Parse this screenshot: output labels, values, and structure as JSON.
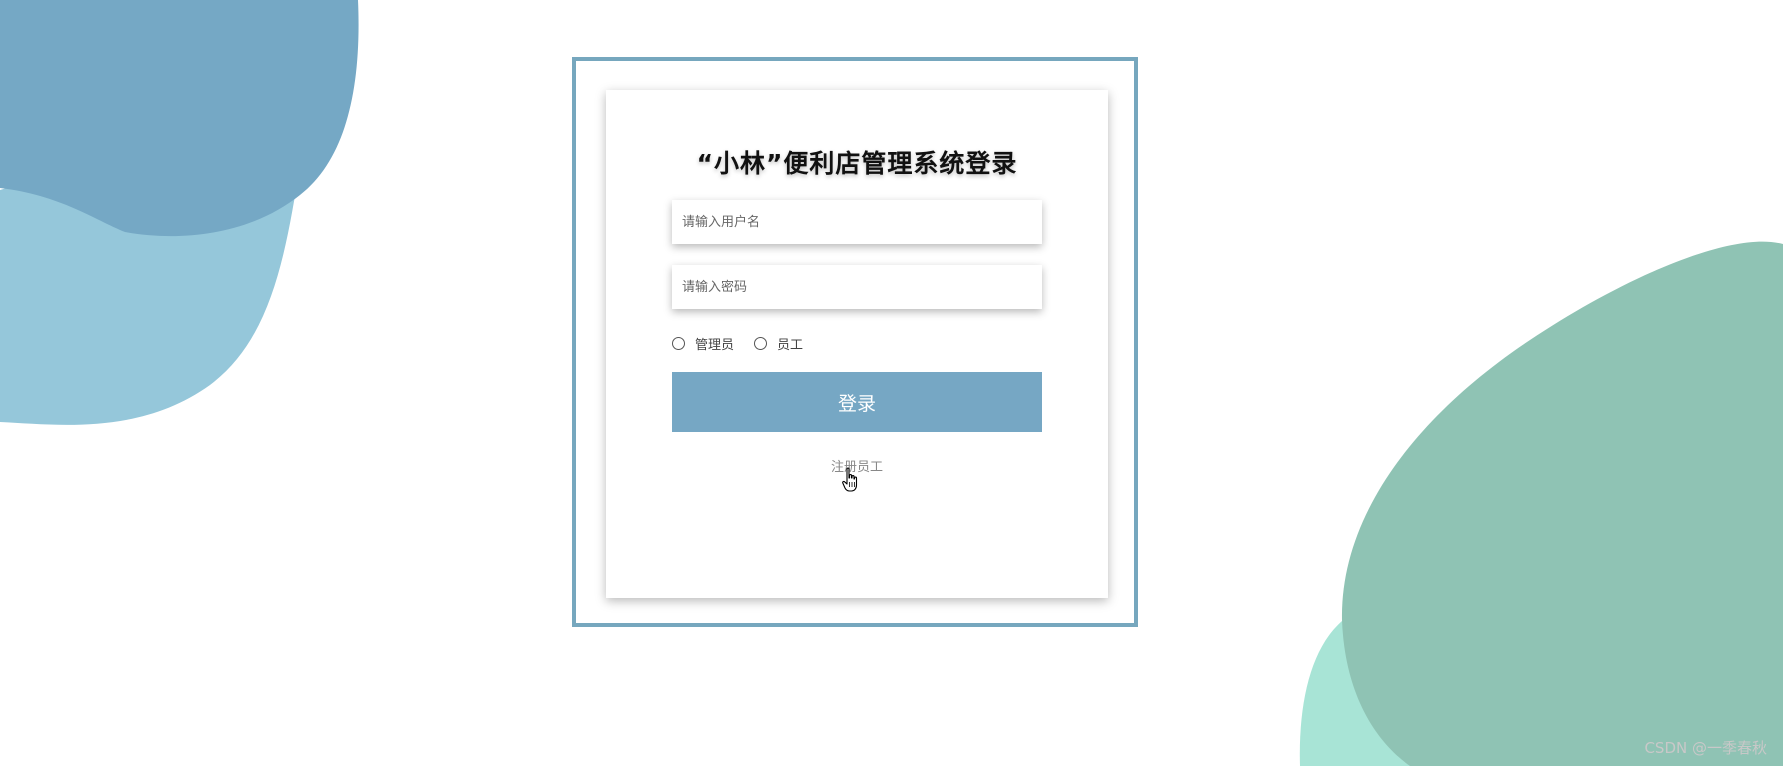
{
  "page": {
    "title": "“小林”便利店管理系统登录"
  },
  "form": {
    "username_placeholder": "请输入用户名",
    "password_placeholder": "请输入密码",
    "roles": [
      {
        "label": "管理员"
      },
      {
        "label": "员工"
      }
    ],
    "login_label": "登录",
    "register_label": "注册员工"
  },
  "watermark": "CSDN @一季春秋",
  "colors": {
    "frame_border": "#76a7be",
    "login_button": "#76a7c4",
    "blob_blue_dark": "#75a8c5",
    "blob_blue_light": "#95c7da",
    "blob_green": "#8fc3b4",
    "blob_mint": "#a8e4d6"
  },
  "icons": {
    "cursor": "hand-pointer-icon"
  }
}
